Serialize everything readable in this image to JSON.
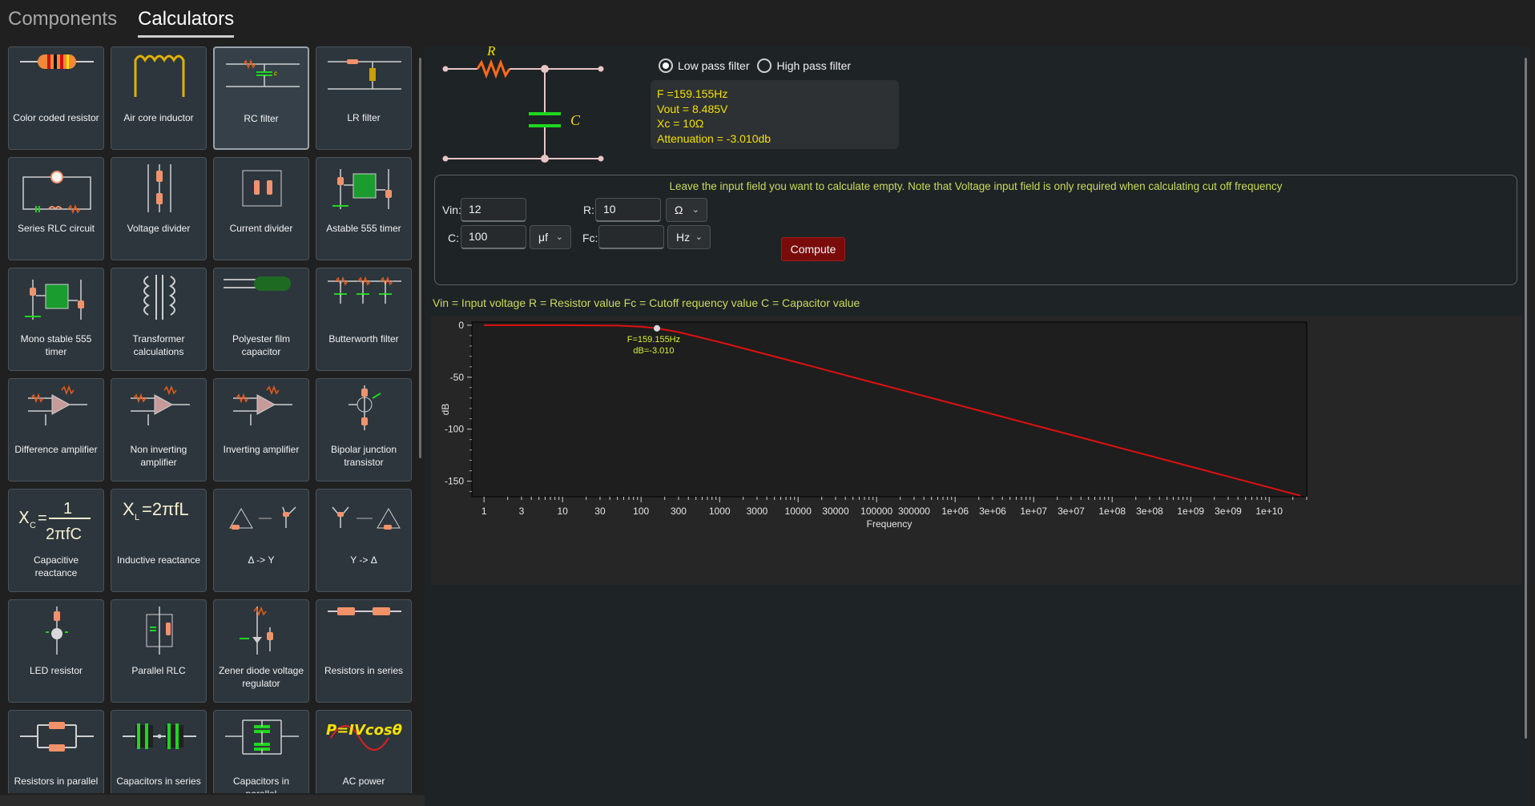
{
  "top_tabs": [
    {
      "label": "Components",
      "active": false
    },
    {
      "label": "Calculators",
      "active": true
    }
  ],
  "calculators": [
    {
      "label": "Color coded resistor",
      "icon": "resistor-icon"
    },
    {
      "label": "Air core inductor",
      "icon": "inductor-icon"
    },
    {
      "label": "RC filter",
      "icon": "rc-filter-icon",
      "selected": true
    },
    {
      "label": "LR filter",
      "icon": "lr-filter-icon"
    },
    {
      "label": "Series RLC circuit",
      "icon": "rlc-circuit-icon"
    },
    {
      "label": "Voltage divider",
      "icon": "voltage-divider-icon"
    },
    {
      "label": "Current divider",
      "icon": "current-divider-icon"
    },
    {
      "label": "Astable 555 timer",
      "icon": "timer-icon"
    },
    {
      "label": "Mono stable 555 timer",
      "icon": "timer-icon"
    },
    {
      "label": "Transformer calculations",
      "icon": "transformer-icon"
    },
    {
      "label": "Polyester film capacitor",
      "icon": "capacitor-icon"
    },
    {
      "label": "Butterworth filter",
      "icon": "filter-icon"
    },
    {
      "label": "Difference amplifier",
      "icon": "opamp-icon"
    },
    {
      "label": "Non inverting amplifier",
      "icon": "opamp-icon"
    },
    {
      "label": "Inverting amplifier",
      "icon": "opamp-icon"
    },
    {
      "label": "Bipolar junction transistor",
      "icon": "transistor-icon"
    },
    {
      "label": "Capacitive reactance",
      "icon": "capacitive-reactance-icon",
      "formula_text": "Xc = 1 / 2πfC"
    },
    {
      "label": "Inductive reactance",
      "icon": "inductive-reactance-icon",
      "formula_text": "XL=2πfL"
    },
    {
      "label": "Δ -> Y",
      "icon": "delta-to-y-icon"
    },
    {
      "label": "Y -> Δ",
      "icon": "y-to-delta-icon"
    },
    {
      "label": "LED resistor",
      "icon": "led-icon"
    },
    {
      "label": "Parallel RLC",
      "icon": "parallel-rlc-icon"
    },
    {
      "label": "Zener diode voltage regulator",
      "icon": "zener-icon"
    },
    {
      "label": "Resistors in series",
      "icon": "series-resistors-icon"
    },
    {
      "label": "Resistors in parallel",
      "icon": "parallel-resistors-icon"
    },
    {
      "label": "Capacitors in series",
      "icon": "series-capacitors-icon"
    },
    {
      "label": "Capacitors in parallel",
      "icon": "parallel-capacitors-icon"
    },
    {
      "label": "AC power",
      "icon": "ac-power-icon",
      "formula_text": "P=IVcosθ"
    }
  ],
  "circuit": {
    "r_label": "R",
    "c_label": "C"
  },
  "filter_options": [
    {
      "label": "Low pass filter",
      "checked": true
    },
    {
      "label": "High  pass filter",
      "checked": false
    }
  ],
  "results": {
    "f": "F =159.155Hz",
    "vout": "Vout = 8.485V",
    "xc": "Xc = 10Ω",
    "attenuation": "Attenuation = -3.010db"
  },
  "form": {
    "hint": "Leave the input field you want to calculate empty.   Note that Voltage input field is only required when calculating cut off frequency",
    "vin_label": "Vin:",
    "vin_value": "12",
    "r_label": "R:",
    "r_value": "10",
    "r_unit": "Ω",
    "c_label": "C:",
    "c_value": "100",
    "c_unit": "μf",
    "fc_label": "Fc:",
    "fc_value": "",
    "fc_unit": "Hz",
    "compute_label": "Compute"
  },
  "legend_text": "Vin = Input voltage   R = Resistor value   Fc = Cutoff requency value   C = Capacitor value",
  "colors": {
    "accent_yellow": "#f5e000",
    "hint_green": "#c9db5a",
    "curve_red": "#e01010",
    "compute_red": "#7a0b0b"
  },
  "chart_data": {
    "type": "line",
    "x_scale": "log",
    "xlabel": "Frequency",
    "ylabel": "dB",
    "xlim": [
      0.7,
      30000000000
    ],
    "ylim": [
      -165,
      3
    ],
    "y_ticks": [
      0,
      -50,
      -100,
      -150
    ],
    "x_ticks": [
      {
        "v": 1,
        "label": "1"
      },
      {
        "v": 3,
        "label": "3"
      },
      {
        "v": 10,
        "label": "10"
      },
      {
        "v": 30,
        "label": "30"
      },
      {
        "v": 100,
        "label": "100"
      },
      {
        "v": 300,
        "label": "300"
      },
      {
        "v": 1000,
        "label": "1000"
      },
      {
        "v": 3000,
        "label": "3000"
      },
      {
        "v": 10000,
        "label": "10000"
      },
      {
        "v": 30000,
        "label": "30000"
      },
      {
        "v": 100000,
        "label": "100000"
      },
      {
        "v": 300000,
        "label": "300000"
      },
      {
        "v": 1000000,
        "label": "1e+06"
      },
      {
        "v": 3000000,
        "label": "3e+06"
      },
      {
        "v": 10000000,
        "label": "1e+07"
      },
      {
        "v": 30000000,
        "label": "3e+07"
      },
      {
        "v": 100000000,
        "label": "1e+08"
      },
      {
        "v": 300000000,
        "label": "3e+08"
      },
      {
        "v": 1000000000,
        "label": "1e+09"
      },
      {
        "v": 3000000000,
        "label": "3e+09"
      },
      {
        "v": 10000000000,
        "label": "1e+10"
      }
    ],
    "series": [
      {
        "color": "#e01010",
        "x": [
          1,
          10,
          50,
          100,
          159.155,
          300,
          1000,
          10000,
          100000,
          1000000,
          10000000,
          100000000,
          1000000000,
          10000000000,
          25000000000
        ],
        "y": [
          0,
          0,
          -0.4,
          -1.5,
          -3.01,
          -6.6,
          -16.3,
          -36.0,
          -56.0,
          -76.0,
          -96.0,
          -116.0,
          -136.0,
          -156.0,
          -164.0
        ]
      }
    ],
    "marker": {
      "x": 159.155,
      "y": -3.01,
      "label_f": "F=159.155Hz",
      "label_db": "dB=-3.010"
    }
  }
}
